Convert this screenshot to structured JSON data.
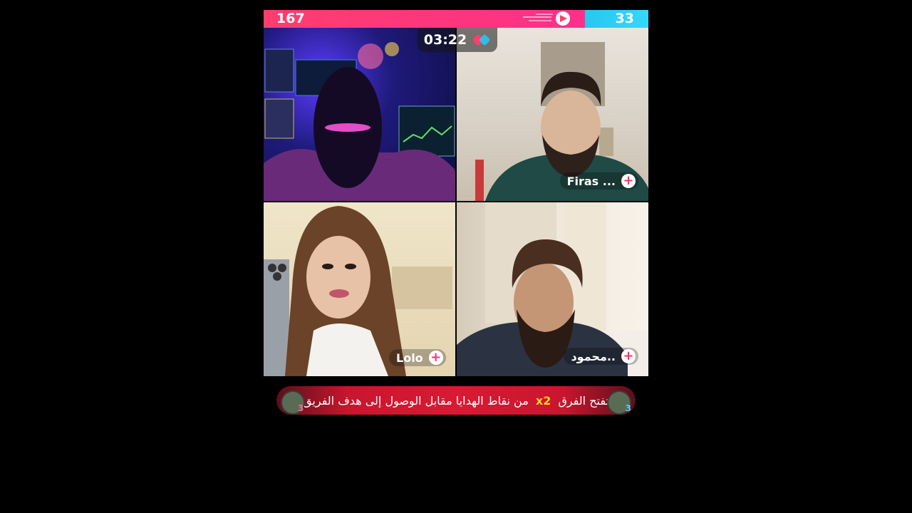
{
  "scores": {
    "left": "167",
    "right": "33",
    "left_ratio": 0.835
  },
  "timer": {
    "value": "03:22",
    "icon": "battle-icon"
  },
  "participants": [
    {
      "name": "",
      "position": "top-left"
    },
    {
      "name": "Firas ...",
      "position": "top-right"
    },
    {
      "name": "Lolo",
      "position": "bottom-left"
    },
    {
      "name": "محمود..",
      "position": "bottom-right"
    }
  ],
  "banner": {
    "text_before": "تفتح الفرق",
    "highlight": "x2",
    "text_after": "من نقاط الهدايا مقابل الوصول إلى هدف الفريق",
    "left_badge": "3",
    "right_badge": "3"
  },
  "colors": {
    "red_team": "#ff3d6e",
    "blue_team": "#28c7f0",
    "highlight": "#ffd21f"
  }
}
